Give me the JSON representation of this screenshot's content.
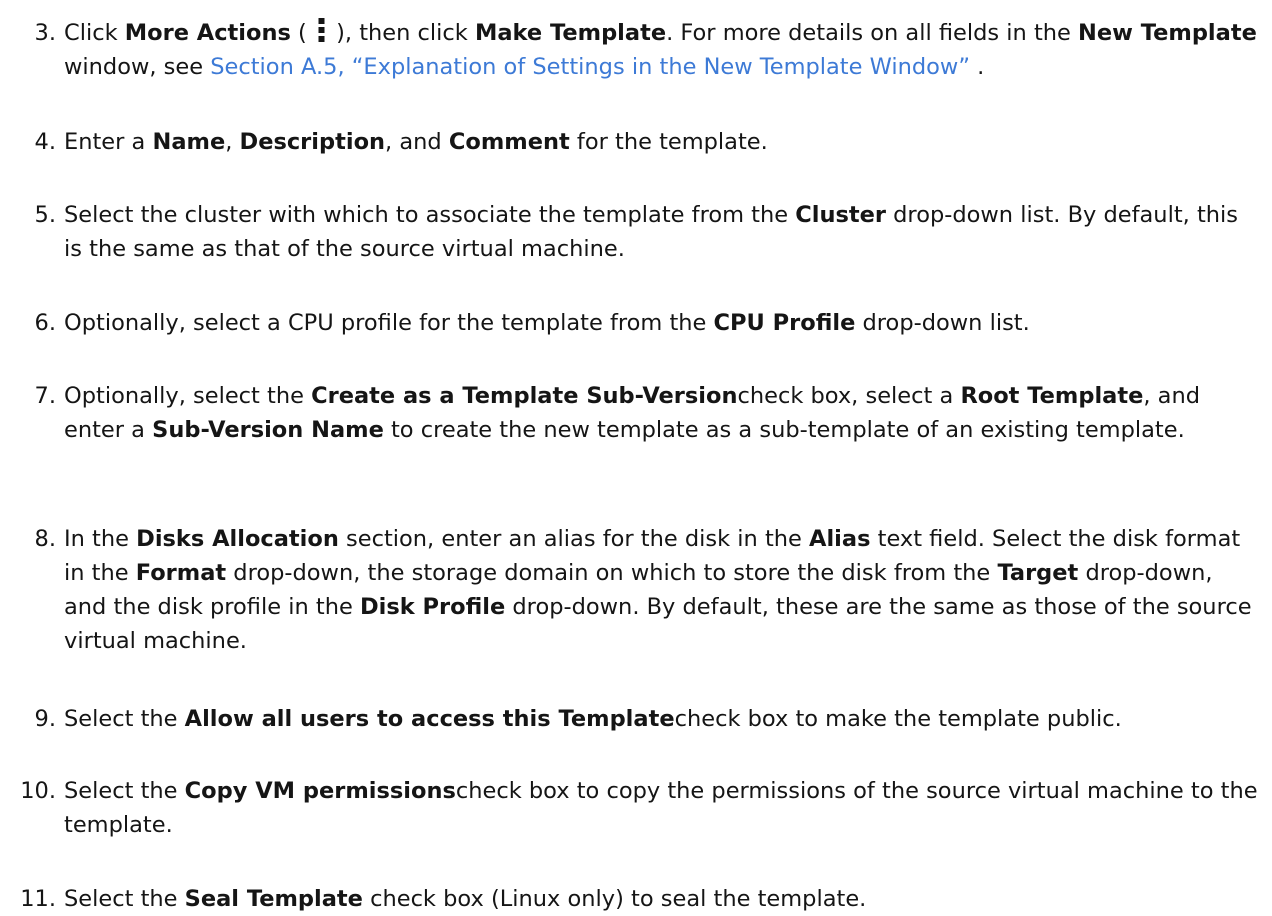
{
  "steps": [
    {
      "num": "3.",
      "parts": [
        {
          "t": "Click "
        },
        {
          "b": "More Actions"
        },
        {
          "t": " ( "
        },
        {
          "icon": "kebab-icon"
        },
        {
          "t": " ), then click "
        },
        {
          "b": "Make Template"
        },
        {
          "t": ". For more details on all fields in the  "
        },
        {
          "b": "New Template"
        },
        {
          "t": " window, see "
        },
        {
          "link": "Section A.5, “Explanation of Settings in the New Template Window”"
        },
        {
          "t": " ."
        }
      ]
    },
    {
      "num": "4.",
      "parts": [
        {
          "t": "Enter a "
        },
        {
          "b": "Name"
        },
        {
          "t": ", "
        },
        {
          "b": "Description"
        },
        {
          "t": ", and "
        },
        {
          "b": "Comment"
        },
        {
          "t": " for the template."
        }
      ]
    },
    {
      "num": "5.",
      "parts": [
        {
          "t": "Select the cluster with which to associate the template from the "
        },
        {
          "b": "Cluster"
        },
        {
          "t": " drop-down list. By default, this is the same as that of the source virtual machine."
        }
      ]
    },
    {
      "num": "6.",
      "parts": [
        {
          "t": "Optionally, select a CPU profile for the template from the "
        },
        {
          "b": "CPU Profile"
        },
        {
          "t": " drop-down list."
        }
      ]
    },
    {
      "num": "7.",
      "parts": [
        {
          "t": "Optionally, select the "
        },
        {
          "b": "Create as a Template Sub-Version"
        },
        {
          "t": "check box, select a  "
        },
        {
          "b": "Root Template"
        },
        {
          "t": ", and enter a "
        },
        {
          "b": "Sub-Version Name"
        },
        {
          "t": " to create the new template as a sub-template of an existing template."
        }
      ]
    },
    {
      "num": "8.",
      "parts": [
        {
          "t": "In the "
        },
        {
          "b": "Disks Allocation"
        },
        {
          "t": " section, enter an alias for the disk in the  "
        },
        {
          "b": "Alias"
        },
        {
          "t": " text field. Select the disk format in the "
        },
        {
          "b": "Format"
        },
        {
          "t": " drop-down, the storage domain on which to store the disk from the "
        },
        {
          "b": "Target"
        },
        {
          "t": " drop-down, and the disk profile in the  "
        },
        {
          "b": "Disk Profile"
        },
        {
          "t": " drop-down. By default, these are the same as those of the source virtual machine."
        }
      ]
    },
    {
      "num": "9.",
      "parts": [
        {
          "t": "Select the "
        },
        {
          "b": "Allow all users to access this Template"
        },
        {
          "t": "check box to make the template public."
        }
      ]
    },
    {
      "num": "10.",
      "parts": [
        {
          "t": "Select the "
        },
        {
          "b": "Copy VM permissions"
        },
        {
          "t": "check box to copy the permissions of the source virtual machine to the template."
        }
      ]
    },
    {
      "num": "11.",
      "parts": [
        {
          "t": "Select the "
        },
        {
          "b": "Seal Template"
        },
        {
          "t": " check box (Linux only) to seal the template."
        }
      ]
    }
  ]
}
